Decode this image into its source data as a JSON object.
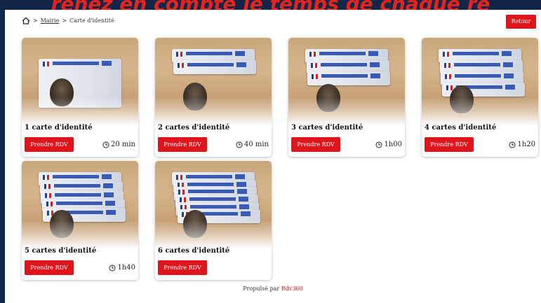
{
  "banner": {
    "text": "renez en compte le temps de chaque re"
  },
  "breadcrumb": {
    "root": "Mairie",
    "separator1": ">",
    "separator0": ">",
    "current": "Carte d'identité"
  },
  "header": {
    "back_label": "Retour"
  },
  "cards": [
    {
      "title": "1 carte d'identité",
      "button": "Prendre RDV",
      "duration": "20 min",
      "count": 1
    },
    {
      "title": "2 cartes d'identité",
      "button": "Prendre RDV",
      "duration": "40 min",
      "count": 2
    },
    {
      "title": "3 cartes d'identité",
      "button": "Prendre RDV",
      "duration": "1h00",
      "count": 3
    },
    {
      "title": "4 cartes d'identité",
      "button": "Prendre RDV",
      "duration": "1h20",
      "count": 4
    },
    {
      "title": "5 cartes d'identité",
      "button": "Prendre RDV",
      "duration": "1h40",
      "count": 5
    },
    {
      "title": "6 cartes d'identité",
      "button": "Prendre RDV",
      "duration": "",
      "count": 6
    }
  ],
  "footer": {
    "prefix": "Propulsé par",
    "brand": "Rdv360"
  },
  "colors": {
    "accent": "#e0141b",
    "outer_background": "#12264a"
  },
  "icons": {
    "home": "home-icon",
    "clock": "clock-icon"
  }
}
